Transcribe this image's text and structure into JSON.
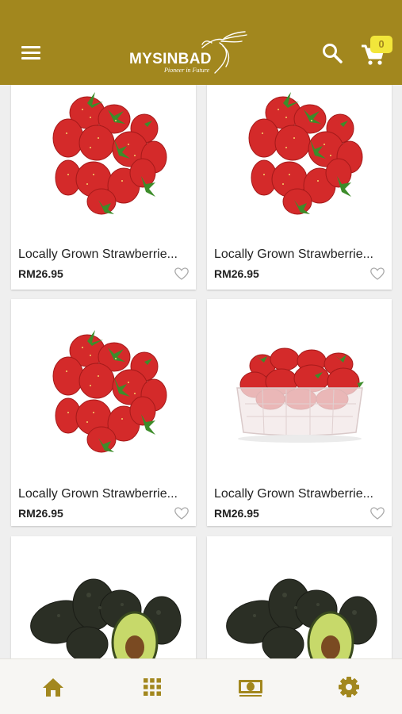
{
  "header": {
    "brand": "MYSINBAD",
    "tagline": "Pioneer in Future",
    "menu_icon": "hamburger-menu-icon",
    "search_icon": "search-icon",
    "cart_icon": "cart-icon",
    "cart_count": "0"
  },
  "products": [
    {
      "name": "Locally Grown Strawberrie...",
      "price": "RM26.95",
      "image": "strawberry-pile"
    },
    {
      "name": "Locally Grown Strawberrie...",
      "price": "RM26.95",
      "image": "strawberry-pile"
    },
    {
      "name": "Locally Grown Strawberrie...",
      "price": "RM26.95",
      "image": "strawberry-pile"
    },
    {
      "name": "Locally Grown Strawberrie...",
      "price": "RM26.95",
      "image": "strawberry-punnet"
    },
    {
      "name": "",
      "price": "",
      "image": "avocado"
    },
    {
      "name": "",
      "price": "",
      "image": "avocado"
    }
  ],
  "bottom_nav": [
    {
      "icon": "home-icon",
      "active": true
    },
    {
      "icon": "grid-icon",
      "active": false
    },
    {
      "icon": "money-icon",
      "active": false
    },
    {
      "icon": "settings-icon",
      "active": false
    }
  ],
  "colors": {
    "brand": "#a2871e",
    "badge": "#f2e63a",
    "strawberry": "#d42a2a",
    "leaf": "#3d8c2a",
    "avocado_skin": "#2b2f25",
    "avocado_flesh": "#c7d96a",
    "avocado_pit": "#7a4a22"
  }
}
